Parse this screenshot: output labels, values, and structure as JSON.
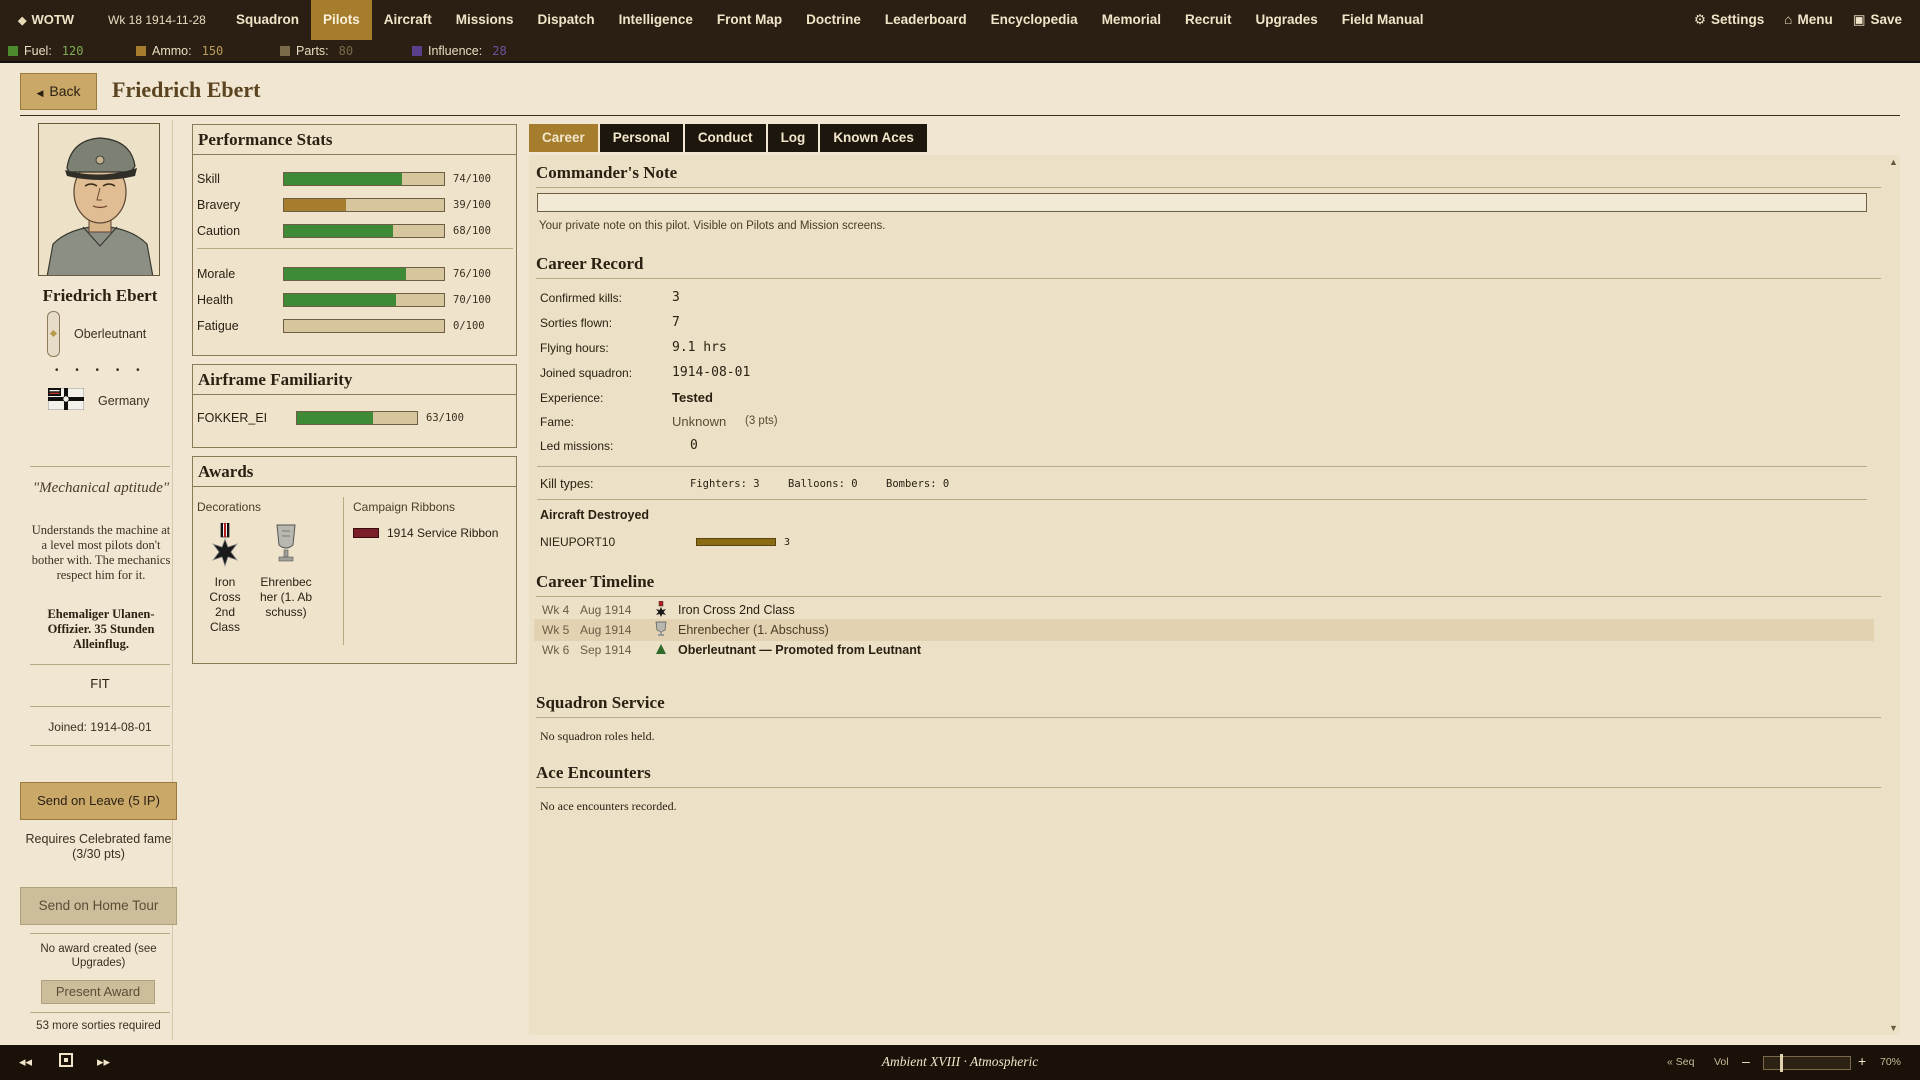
{
  "nav": {
    "brand": "WOTW",
    "week": "Wk 18  1914-11-28",
    "items": [
      "Squadron",
      "Pilots",
      "Aircraft",
      "Missions",
      "Dispatch",
      "Intelligence",
      "Front Map",
      "Doctrine",
      "Leaderboard",
      "Encyclopedia",
      "Memorial",
      "Recruit",
      "Upgrades",
      "Field Manual"
    ],
    "active": "Pilots",
    "settings": "Settings",
    "menu": "Menu",
    "save": "Save"
  },
  "resources": [
    {
      "label": "Fuel:",
      "value": "120",
      "color": "#4c8a2e",
      "valcolor": "#7fae52"
    },
    {
      "label": "Ammo:",
      "value": "150",
      "color": "#a57d2d",
      "valcolor": "#b99a58"
    },
    {
      "label": "Parts:",
      "value": "80",
      "color": "#7a6a4a",
      "valcolor": "#7a6a4a"
    },
    {
      "label": "Influence:",
      "value": "28",
      "color": "#5a3f8a",
      "valcolor": "#6b55a3"
    }
  ],
  "header": {
    "back": "Back",
    "title": "Friedrich Ebert"
  },
  "pilot": {
    "name": "Friedrich Ebert",
    "rank": "Oberleutnant",
    "dots": "• • • • •",
    "country": "Germany",
    "trait": "\"Mechanical aptitude\"",
    "trait_desc": "Understands the machine at a level most pilots don't bother with. The mechanics respect him for it.",
    "bio": "Ehemaliger Ulanen-Offizier. 35 Stunden Alleinflug.",
    "status": "FIT",
    "joined": "Joined:  1914-08-01"
  },
  "actions": {
    "leave": "Send on Leave  (5 IP)",
    "requires": "Requires Celebrated fame",
    "requires_pts": "(3/30 pts)",
    "home_tour": "Send on Home Tour",
    "no_award": "No award created (see Upgrades)",
    "present_award": "Present Award",
    "sorties_required": "53 more sorties required"
  },
  "performance": {
    "title": "Performance Stats",
    "stats": [
      {
        "label": "Skill",
        "value": 74,
        "text": "74/100",
        "color": "#3f8a36"
      },
      {
        "label": "Bravery",
        "value": 39,
        "text": "39/100",
        "color": "#a57d2d"
      },
      {
        "label": "Caution",
        "value": 68,
        "text": "68/100",
        "color": "#3f8a36"
      },
      {
        "label": "Morale",
        "value": 76,
        "text": "76/100",
        "color": "#3f8a36"
      },
      {
        "label": "Health",
        "value": 70,
        "text": "70/100",
        "color": "#3f8a36"
      },
      {
        "label": "Fatigue",
        "value": 0,
        "text": "0/100",
        "color": "#3f8a36"
      }
    ]
  },
  "airframe": {
    "title": "Airframe Familiarity",
    "items": [
      {
        "label": "FOKKER_EI",
        "value": 63,
        "text": "63/100",
        "color": "#3f8a36"
      }
    ]
  },
  "awards": {
    "title": "Awards",
    "decorations_label": "Decorations",
    "ribbons_label": "Campaign Ribbons",
    "decorations": [
      "Iron Cross 2nd Class",
      "Ehrenbecher (1. Abschuss)"
    ],
    "ribbon": "1914 Service Ribbon"
  },
  "tabs": [
    "Career",
    "Personal",
    "Conduct",
    "Log",
    "Known Aces"
  ],
  "active_tab": "Career",
  "note": {
    "title": "Commander's Note",
    "value": "",
    "hint": "Your private note on this pilot. Visible on Pilots and Mission screens."
  },
  "record": {
    "title": "Career Record",
    "rows": [
      {
        "label": "Confirmed kills:",
        "value": "3"
      },
      {
        "label": "Sorties flown:",
        "value": "7"
      },
      {
        "label": "Flying hours:",
        "value": "9.1 hrs"
      },
      {
        "label": "Joined squadron:",
        "value": "1914-08-01"
      },
      {
        "label": "Experience:",
        "value": "Tested"
      },
      {
        "label": "Fame:",
        "value": "Unknown",
        "extra": "(3 pts)"
      },
      {
        "label": "Led missions:",
        "value": "0"
      }
    ],
    "kill_types_label": "Kill types:",
    "kill_types": [
      "Fighters: 3",
      "Balloons: 0",
      "Bombers: 0"
    ],
    "destroyed_title": "Aircraft Destroyed",
    "destroyed": [
      {
        "label": "NIEUPORT10",
        "count": "3"
      }
    ]
  },
  "timeline": {
    "title": "Career Timeline",
    "rows": [
      {
        "wk": "Wk 4",
        "date": "Aug 1914",
        "text": "Iron Cross 2nd Class",
        "icon": "iron-cross-icon"
      },
      {
        "wk": "Wk 5",
        "date": "Aug 1914",
        "text": "Ehrenbecher (1. Abschuss)",
        "icon": "cup-icon"
      },
      {
        "wk": "Wk 6",
        "date": "Sep 1914",
        "text": "Oberleutnant  —  Promoted from Leutnant",
        "icon": "promotion-arrow-icon"
      }
    ]
  },
  "squadron_service": {
    "title": "Squadron Service",
    "text": "No squadron roles held."
  },
  "ace_encounters": {
    "title": "Ace Encounters",
    "text": "No ace encounters recorded."
  },
  "audio": {
    "track": "Ambient XVIII  ·  Atmospheric",
    "seq": "« Seq",
    "vol": "Vol",
    "minus": "–",
    "plus": "+",
    "pct": "70%",
    "volume": 0.7
  }
}
